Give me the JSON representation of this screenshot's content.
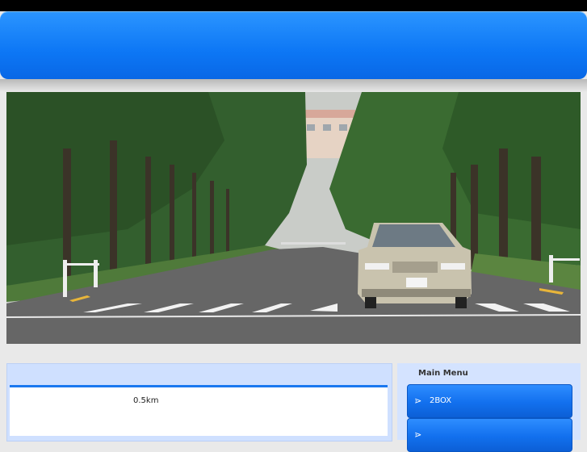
{
  "header": {
    "title": ""
  },
  "hero": {
    "alt": "tree-lined road with silver sedan at crosswalk"
  },
  "main": {
    "distance_text": "0.5km"
  },
  "sidebar": {
    "title": "Main Menu",
    "items": [
      {
        "label": "2BOX",
        "icon": "chevron-right-icon"
      },
      {
        "label": "",
        "icon": "chevron-right-icon"
      }
    ]
  }
}
